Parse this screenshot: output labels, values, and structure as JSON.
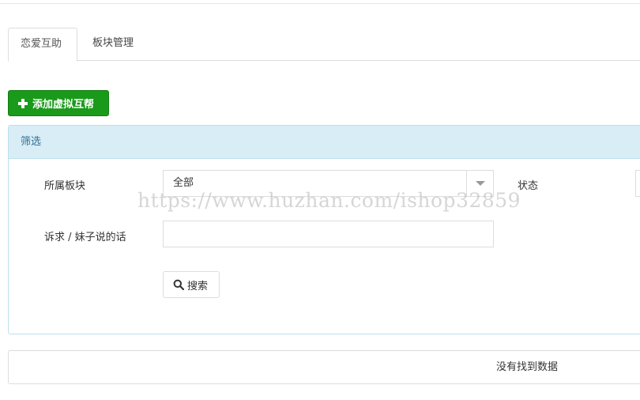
{
  "tabs": [
    {
      "label": "恋爱互助",
      "active": true
    },
    {
      "label": "板块管理",
      "active": false
    }
  ],
  "toolbar": {
    "add_label": "添加虚拟互帮",
    "add_color": "#1a9a1a"
  },
  "filter": {
    "title": "筛选",
    "board_label": "所属板块",
    "board_value": "全部",
    "status_label": "状态",
    "appeal_label": "诉求 / 妹子说的话",
    "appeal_value": "",
    "search_label": "搜索",
    "header_color": "#d9edf7"
  },
  "watermark": "https://www.huzhan.com/ishop32859",
  "results": {
    "empty_text": "没有找到数据"
  }
}
